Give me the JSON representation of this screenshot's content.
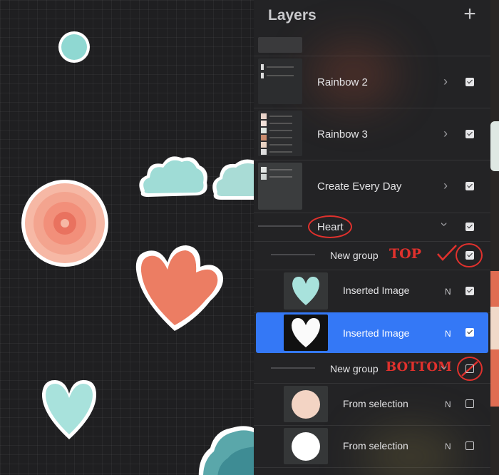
{
  "panel": {
    "title": "Layers",
    "add_icon": "plus-icon"
  },
  "layers": [
    {
      "name": "Rainbow 2",
      "type": "group",
      "expanded": false,
      "visible": true
    },
    {
      "name": "Rainbow 3",
      "type": "group",
      "expanded": false,
      "visible": true
    },
    {
      "name": "Create Every Day",
      "type": "group",
      "expanded": false,
      "visible": true
    },
    {
      "name": "Heart",
      "type": "group",
      "expanded": true,
      "visible": true
    },
    {
      "name": "New group",
      "type": "group",
      "expanded": true,
      "visible": true
    },
    {
      "name": "Inserted Image",
      "blend": "N",
      "visible": true,
      "selected": false
    },
    {
      "name": "Inserted Image",
      "blend": "N",
      "visible": true,
      "selected": true
    },
    {
      "name": "New group",
      "type": "group",
      "expanded": true,
      "visible": false
    },
    {
      "name": "From selection",
      "blend": "N",
      "visible": false
    },
    {
      "name": "From selection",
      "blend": "N",
      "visible": false
    }
  ],
  "thumb_text": {
    "rainbow2": [
      "New group",
      "New group"
    ],
    "rainbow3": [
      "From selection",
      "From selection",
      "Layer 103",
      "Layer 102",
      "Layer 101",
      "Layer 100"
    ],
    "create": [
      "Layer 99",
      "Layer 98"
    ]
  },
  "annotations": {
    "top": "TOP",
    "bottom": "BOTTOM"
  },
  "colors": {
    "selected": "#3478f6",
    "annotation": "#e0312d",
    "panel_bg": "#232325"
  }
}
